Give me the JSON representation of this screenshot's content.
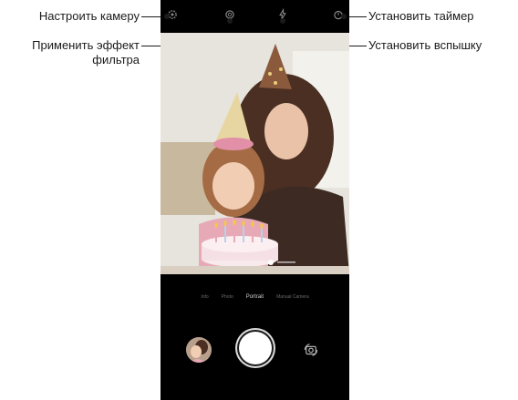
{
  "callouts": {
    "configure_camera": "Настроить камеру",
    "apply_filter": "Применить эффект фильтра",
    "set_timer": "Установить таймер",
    "set_flash": "Установить вспышку"
  },
  "topbar_icons": [
    "settings-icon",
    "filter-icon",
    "flash-icon",
    "timer-icon"
  ],
  "modes": [
    "Info",
    "Photo",
    "Portrait",
    "Manual Camera"
  ],
  "active_mode": "Portrait",
  "bottom_controls": [
    "gallery-thumbnail",
    "shutter-button",
    "switch-camera-button"
  ],
  "colors": {
    "screen_bg": "#000000",
    "callout_text": "#1a1a1a",
    "shutter": "#ffffff"
  }
}
